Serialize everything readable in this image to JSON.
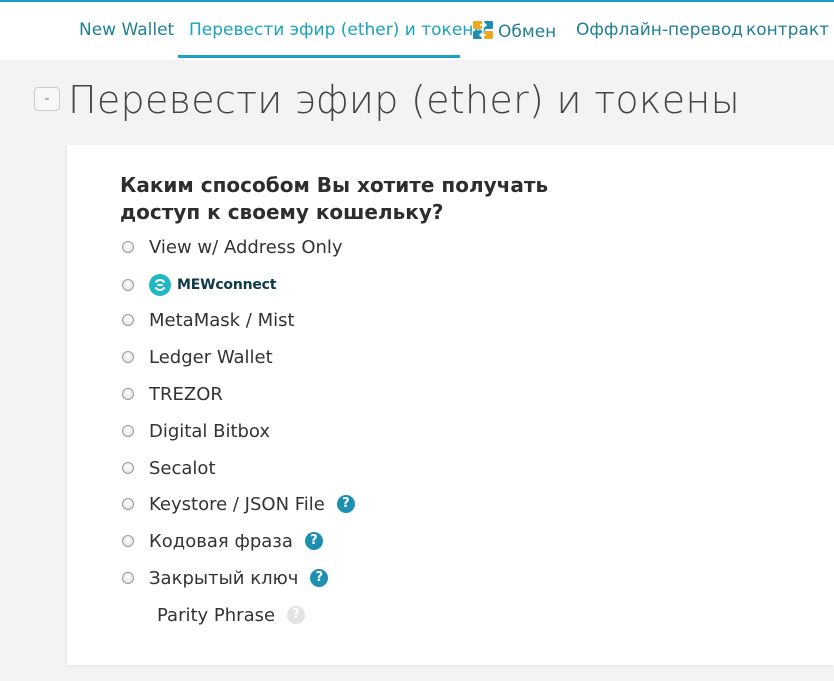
{
  "nav": {
    "items": [
      {
        "label": "New Wallet"
      },
      {
        "label": "Перевести эфир (ether) и токены"
      },
      {
        "label": "Обмен"
      },
      {
        "label": "Оффлайн-перевод"
      },
      {
        "label": "контракт"
      }
    ]
  },
  "heading": {
    "collapse_symbol": "-",
    "title": "Перевести эфир (ether) и токены"
  },
  "access": {
    "question": "Каким способом Вы хотите получать доступ к своему кошельку?",
    "help_symbol": "?",
    "options": [
      {
        "label": "View w/ Address Only"
      },
      {
        "label": "MEWconnect"
      },
      {
        "label": "MetaMask / Mist"
      },
      {
        "label": "Ledger Wallet"
      },
      {
        "label": "TREZOR"
      },
      {
        "label": "Digital Bitbox"
      },
      {
        "label": "Secalot"
      },
      {
        "label": "Keystore / JSON File"
      },
      {
        "label": "Кодовая фраза"
      },
      {
        "label": "Закрытый ключ"
      },
      {
        "label": "Parity Phrase"
      }
    ]
  },
  "colors": {
    "accent": "#19a3c0",
    "help_icon": "#1e8fb0",
    "help_icon_muted": "#e3e3e3",
    "mew_brand": "#1fb8c9"
  }
}
